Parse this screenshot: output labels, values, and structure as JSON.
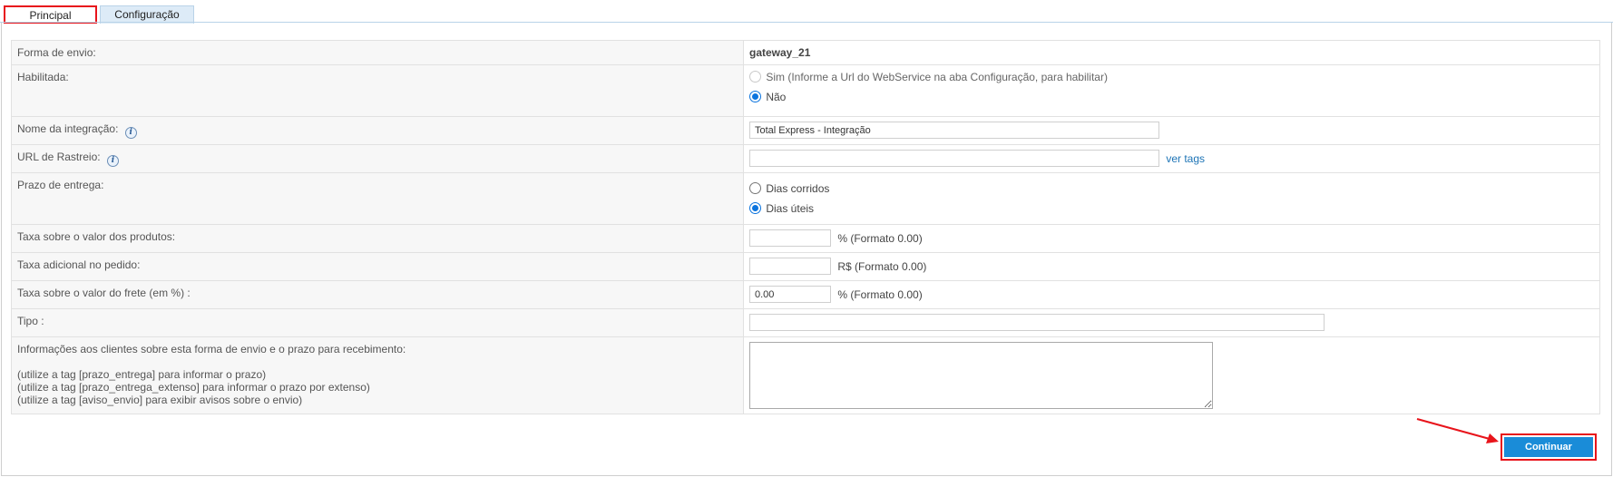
{
  "tabs": [
    {
      "label": "Principal",
      "active": true
    },
    {
      "label": "Configuração",
      "active": false
    }
  ],
  "form": {
    "forma_envio": {
      "label": "Forma de envio:",
      "value": "gateway_21"
    },
    "habilitada": {
      "label": "Habilitada:",
      "options": [
        {
          "label": "Sim (Informe a Url do WebService na aba Configuração, para habilitar)",
          "checked": false,
          "disabled": true
        },
        {
          "label": "Não",
          "checked": true,
          "disabled": false
        }
      ]
    },
    "nome_integracao": {
      "label": "Nome da integração:",
      "value": "Total Express - Integração",
      "icon": "info-icon"
    },
    "url_rastreio": {
      "label": "URL de Rastreio:",
      "value": "",
      "icon": "info-icon",
      "link": "ver tags"
    },
    "prazo_entrega": {
      "label": "Prazo de entrega:",
      "options": [
        {
          "label": "Dias corridos",
          "checked": false
        },
        {
          "label": "Dias úteis",
          "checked": true
        }
      ]
    },
    "taxa_produtos": {
      "label": "Taxa sobre o valor dos produtos:",
      "value": "",
      "suffix": "% (Formato 0.00)"
    },
    "taxa_adicional": {
      "label": "Taxa adicional no pedido:",
      "value": "",
      "suffix": "R$ (Formato 0.00)"
    },
    "taxa_frete": {
      "label": "Taxa sobre o valor do frete (em %) :",
      "value": "0.00",
      "suffix": "% (Formato 0.00)"
    },
    "tipo": {
      "label": "Tipo :",
      "value": ""
    },
    "informacoes": {
      "label": "Informações aos clientes sobre esta forma de envio e o prazo para recebimento:",
      "help": [
        "(utilize a tag [prazo_entrega] para informar o prazo)",
        "(utilize a tag [prazo_entrega_extenso] para informar o prazo por extenso)",
        "(utilize a tag [aviso_envio] para exibir avisos sobre o envio)"
      ],
      "value": ""
    }
  },
  "actions": {
    "continue_label": "Continuar"
  },
  "colors": {
    "accent": "#1a8cd8",
    "highlight": "#e8141b",
    "link": "#1d74b6"
  }
}
